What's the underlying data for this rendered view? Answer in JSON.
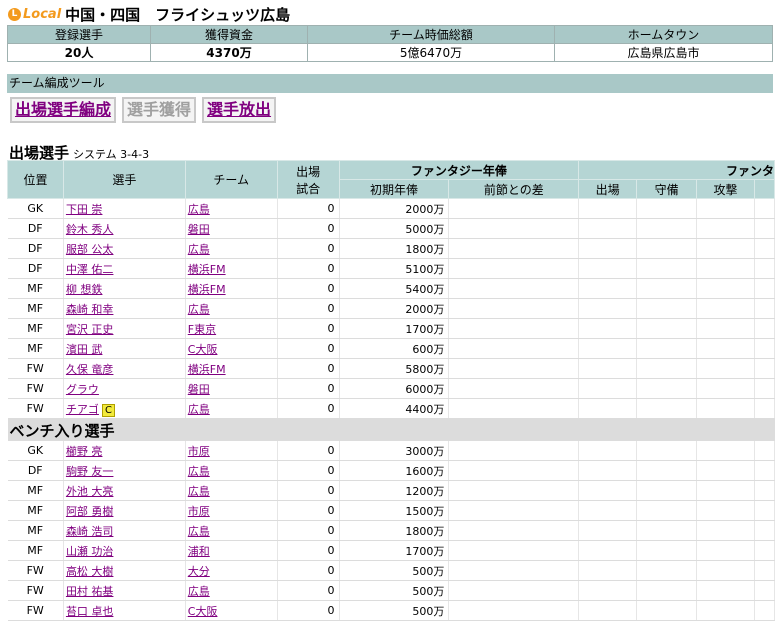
{
  "header": {
    "badge_letter": "L",
    "badge_word": "Local",
    "title": "中国・四国　フライシュッツ広島"
  },
  "summary": {
    "headers": [
      "登録選手",
      "獲得資金",
      "チーム時価総額",
      "ホームタウン"
    ],
    "values": [
      "20人",
      "4370万",
      "5億6470万",
      "広島県広島市"
    ]
  },
  "toolbar": {
    "label": "チーム編成ツール",
    "buttons": [
      "出場選手編成",
      "選手獲得",
      "選手放出"
    ]
  },
  "section": {
    "title": "出場選手",
    "system": "システム 3-4-3"
  },
  "table_headers": {
    "position": "位置",
    "player": "選手",
    "team": "チーム",
    "games_line1": "出場",
    "games_line2": "試合",
    "salary_group": "ファンタジー年俸",
    "initial_salary": "初期年俸",
    "diff": "前節との差",
    "points_group": "ファンタ",
    "appearance": "出場",
    "defense": "守備",
    "attack": "攻撃"
  },
  "starters": [
    {
      "pos": "GK",
      "name": "下田 崇",
      "team": "広島",
      "games": "0",
      "salary": "2000万"
    },
    {
      "pos": "DF",
      "name": "鈴木 秀人",
      "team": "磐田",
      "games": "0",
      "salary": "5000万"
    },
    {
      "pos": "DF",
      "name": "服部 公太",
      "team": "広島",
      "games": "0",
      "salary": "1800万"
    },
    {
      "pos": "DF",
      "name": "中澤 佑二",
      "team": "横浜FM",
      "games": "0",
      "salary": "5100万"
    },
    {
      "pos": "MF",
      "name": "柳 想鉄",
      "team": "横浜FM",
      "games": "0",
      "salary": "5400万"
    },
    {
      "pos": "MF",
      "name": "森崎 和幸",
      "team": "広島",
      "games": "0",
      "salary": "2000万"
    },
    {
      "pos": "MF",
      "name": "宮沢 正史",
      "team": "F東京",
      "games": "0",
      "salary": "1700万"
    },
    {
      "pos": "MF",
      "name": "濱田 武",
      "team": "C大阪",
      "games": "0",
      "salary": "600万"
    },
    {
      "pos": "FW",
      "name": "久保 竜彦",
      "team": "横浜FM",
      "games": "0",
      "salary": "5800万"
    },
    {
      "pos": "FW",
      "name": "グラウ",
      "team": "磐田",
      "games": "0",
      "salary": "6000万"
    },
    {
      "pos": "FW",
      "name": "チアゴ",
      "team": "広島",
      "games": "0",
      "salary": "4400万",
      "captain": "C"
    }
  ],
  "bench_title": "ベンチ入り選手",
  "bench": [
    {
      "pos": "GK",
      "name": "櫛野 亮",
      "team": "市原",
      "games": "0",
      "salary": "3000万"
    },
    {
      "pos": "DF",
      "name": "駒野 友一",
      "team": "広島",
      "games": "0",
      "salary": "1600万"
    },
    {
      "pos": "MF",
      "name": "外池 大亮",
      "team": "広島",
      "games": "0",
      "salary": "1200万"
    },
    {
      "pos": "MF",
      "name": "阿部 勇樹",
      "team": "市原",
      "games": "0",
      "salary": "1500万"
    },
    {
      "pos": "MF",
      "name": "森崎 浩司",
      "team": "広島",
      "games": "0",
      "salary": "1800万"
    },
    {
      "pos": "MF",
      "name": "山瀬 功治",
      "team": "浦和",
      "games": "0",
      "salary": "1700万"
    },
    {
      "pos": "FW",
      "name": "高松 大樹",
      "team": "大分",
      "games": "0",
      "salary": "500万"
    },
    {
      "pos": "FW",
      "name": "田村 祐基",
      "team": "広島",
      "games": "0",
      "salary": "500万"
    },
    {
      "pos": "FW",
      "name": "苔口 卓也",
      "team": "C大阪",
      "games": "0",
      "salary": "500万"
    }
  ]
}
